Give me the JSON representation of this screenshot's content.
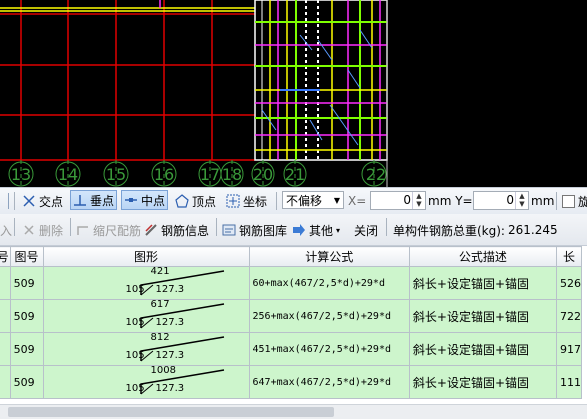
{
  "cad": {
    "axis_labels": [
      "13",
      "14",
      "15",
      "16",
      "17",
      "18",
      "20",
      "21",
      "22"
    ]
  },
  "snap_toolbar": {
    "items": [
      {
        "label": "交点",
        "icon": "intersection-icon",
        "pressed": false
      },
      {
        "label": "垂点",
        "icon": "perpendicular-icon",
        "pressed": true
      },
      {
        "label": "中点",
        "icon": "midpoint-icon",
        "pressed": true
      },
      {
        "label": "顶点",
        "icon": "vertex-icon",
        "pressed": false
      },
      {
        "label": "坐标",
        "icon": "coordinate-icon",
        "pressed": false
      }
    ],
    "offset_mode": "不偏移",
    "x_label": "X=",
    "x_value": "0",
    "unit_x": "mm Y=",
    "y_value": "0",
    "unit_y": "mm",
    "trailing": "旋"
  },
  "rebar_toolbar": {
    "insert": "入",
    "delete": "删除",
    "scale_rebar": "缩尺配筋",
    "rebar_info": "钢筋信息",
    "rebar_library": "钢筋图库",
    "other": "其他",
    "close": "关闭",
    "total_label": "单构件钢筋总重(kg):",
    "total_value": "261.245"
  },
  "table": {
    "columns": [
      "号",
      "图号",
      "图形",
      "计算公式",
      "公式描述",
      "长"
    ],
    "rows": [
      {
        "no": "",
        "fig": "509",
        "top": "421",
        "left": "105",
        "bottom": "127.3",
        "formula": "60+max(467/2,5*d)+29*d",
        "desc": "斜长+设定锚固+锚固",
        "len": "526"
      },
      {
        "no": "",
        "fig": "509",
        "top": "617",
        "left": "105",
        "bottom": "127.3",
        "formula": "256+max(467/2,5*d)+29*d",
        "desc": "斜长+设定锚固+锚固",
        "len": "722"
      },
      {
        "no": "",
        "fig": "509",
        "top": "812",
        "left": "105",
        "bottom": "127.3",
        "formula": "451+max(467/2,5*d)+29*d",
        "desc": "斜长+设定锚固+锚固",
        "len": "917"
      },
      {
        "no": "",
        "fig": "509",
        "top": "1008",
        "left": "105",
        "bottom": "127.3",
        "formula": "647+max(467/2,5*d)+29*d",
        "desc": "斜长+设定锚固+锚固",
        "len": "111"
      }
    ]
  }
}
